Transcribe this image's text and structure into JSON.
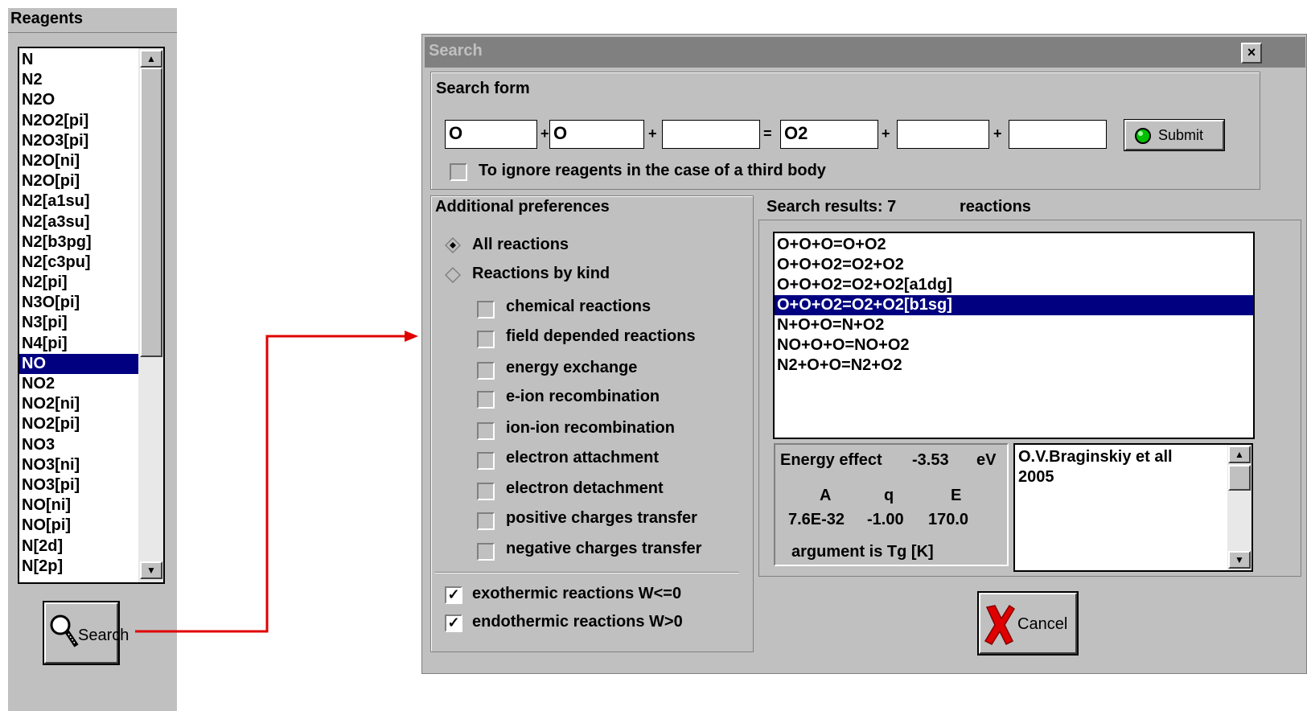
{
  "reagents_panel": {
    "title": "Reagents",
    "items": [
      "N",
      "N2",
      "N2O",
      "N2O2[pi]",
      "N2O3[pi]",
      "N2O[ni]",
      "N2O[pi]",
      "N2[a1su]",
      "N2[a3su]",
      "N2[b3pg]",
      "N2[c3pu]",
      "N2[pi]",
      "N3O[pi]",
      "N3[pi]",
      "N4[pi]",
      "NO",
      "NO2",
      "NO2[ni]",
      "NO2[pi]",
      "NO3",
      "NO3[ni]",
      "NO3[pi]",
      "NO[ni]",
      "NO[pi]",
      "N[2d]",
      "N[2p]"
    ],
    "selected_item": "NO",
    "search_button_label": "Search",
    "search_icon": "magnifier-icon"
  },
  "dialog": {
    "title": "Search",
    "close_label": "×",
    "search_form": {
      "label": "Search form",
      "fields": [
        "O",
        "O",
        "",
        "O2",
        "",
        ""
      ],
      "plus": "+",
      "equals": "=",
      "submit_label": "Submit",
      "ignore_label": "To ignore reagents in the case of a third body",
      "ignore_checked": false
    },
    "preferences": {
      "label": "Additional preferences",
      "radio_all": "All reactions",
      "radio_kind": "Reactions by kind",
      "radio_selected": "All reactions",
      "kinds": [
        "chemical reactions",
        "field depended reactions",
        "energy exchange",
        "e-ion recombination",
        "ion-ion recombination",
        "electron attachment",
        "electron detachment",
        "positive charges transfer",
        "negative charges transfer"
      ],
      "exothermic_label": "exothermic reactions W<=0",
      "endothermic_label": "endothermic reactions W>0",
      "exothermic_checked": true,
      "endothermic_checked": true,
      "check_mark": "✓"
    },
    "results": {
      "label_prefix": "Search results: 7",
      "label_suffix": "reactions",
      "items": [
        "O+O+O=O+O2",
        "O+O+O2=O2+O2",
        "O+O+O2=O2+O2[a1dg]",
        "O+O+O2=O2+O2[b1sg]",
        "N+O+O=N+O2",
        "NO+O+O=NO+O2",
        "N2+O+O=N2+O2"
      ],
      "selected_index": 3
    },
    "energy": {
      "effect_label": "Energy effect",
      "effect_value": "-3.53",
      "effect_unit": "eV",
      "col_a": "A",
      "col_q": "q",
      "col_e": "E",
      "val_a": "7.6E-32",
      "val_q": "-1.00",
      "val_e": "170.0",
      "argument": "argument is Tg [K]"
    },
    "reference": {
      "line1": "O.V.Braginskiy et all",
      "line2": "2005"
    },
    "cancel_label": "Cancel",
    "colors": {
      "selection": "#000080",
      "arrow": "#e00000",
      "face": "#c0c0c0"
    }
  }
}
